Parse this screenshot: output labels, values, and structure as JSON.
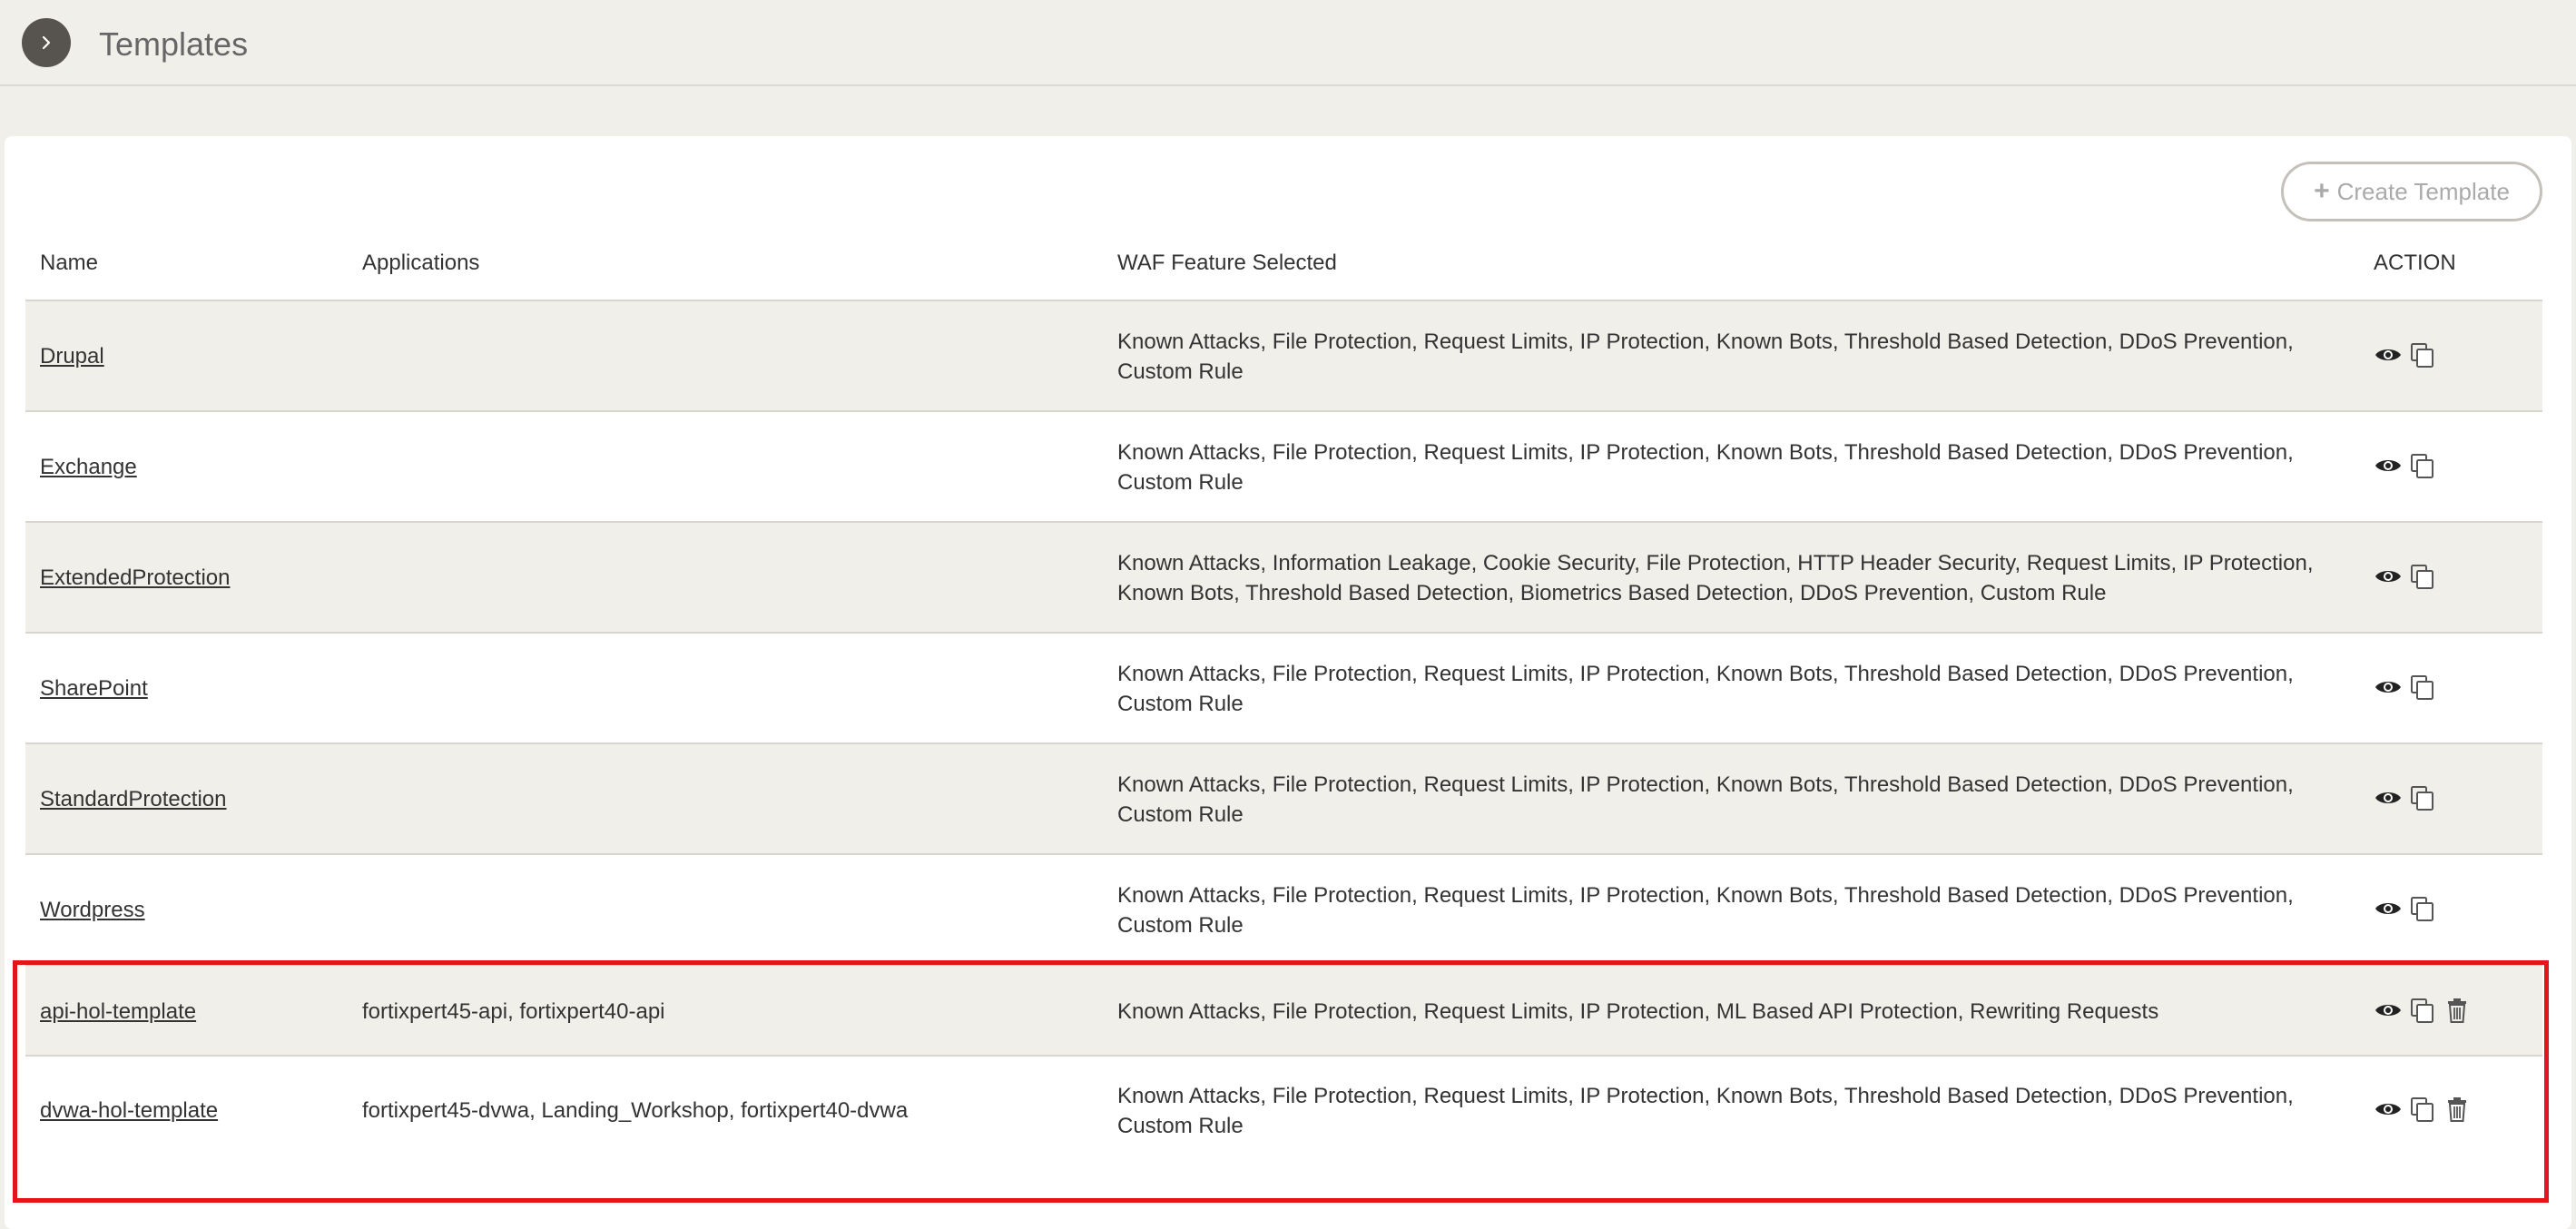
{
  "header": {
    "title": "Templates"
  },
  "toolbar": {
    "create_label": "Create Template"
  },
  "table": {
    "columns": [
      "Name",
      "Applications",
      "WAF Feature Selected",
      "ACTION"
    ],
    "rows": [
      {
        "name": "Drupal",
        "applications": "",
        "waf": "Known Attacks, File Protection, Request Limits, IP Protection, Known Bots, Threshold Based Detection, DDoS Prevention, Custom Rule",
        "actions": [
          "view-icon",
          "copy-icon"
        ]
      },
      {
        "name": "Exchange",
        "applications": "",
        "waf": "Known Attacks, File Protection, Request Limits, IP Protection, Known Bots, Threshold Based Detection, DDoS Prevention, Custom Rule",
        "actions": [
          "view-icon",
          "copy-icon"
        ]
      },
      {
        "name": "ExtendedProtection",
        "applications": "",
        "waf": "Known Attacks, Information Leakage, Cookie Security, File Protection, HTTP Header Security, Request Limits, IP Protection, Known Bots, Threshold Based Detection, Biometrics Based Detection, DDoS Prevention, Custom Rule",
        "actions": [
          "view-icon",
          "copy-icon"
        ]
      },
      {
        "name": "SharePoint",
        "applications": "",
        "waf": "Known Attacks, File Protection, Request Limits, IP Protection, Known Bots, Threshold Based Detection, DDoS Prevention, Custom Rule",
        "actions": [
          "view-icon",
          "copy-icon"
        ]
      },
      {
        "name": "StandardProtection",
        "applications": "",
        "waf": "Known Attacks, File Protection, Request Limits, IP Protection, Known Bots, Threshold Based Detection, DDoS Prevention, Custom Rule",
        "actions": [
          "view-icon",
          "copy-icon"
        ]
      },
      {
        "name": "Wordpress",
        "applications": "",
        "waf": "Known Attacks, File Protection, Request Limits, IP Protection, Known Bots, Threshold Based Detection, DDoS Prevention, Custom Rule",
        "actions": [
          "view-icon",
          "copy-icon"
        ]
      },
      {
        "name": "api-hol-template",
        "applications": "fortixpert45-api, fortixpert40-api",
        "waf": "Known Attacks, File Protection, Request Limits, IP Protection, ML Based API Protection, Rewriting Requests",
        "actions": [
          "view-icon",
          "copy-icon",
          "trash-icon"
        ]
      },
      {
        "name": "dvwa-hol-template",
        "applications": "fortixpert45-dvwa, Landing_Workshop, fortixpert40-dvwa",
        "waf": "Known Attacks, File Protection, Request Limits, IP Protection, Known Bots, Threshold Based Detection, DDoS Prevention, Custom Rule",
        "actions": [
          "view-icon",
          "copy-icon",
          "trash-icon"
        ]
      }
    ]
  },
  "colors": {
    "page_bg": "#f1efea",
    "card_bg": "#ffffff",
    "highlight": "#e3141b"
  }
}
